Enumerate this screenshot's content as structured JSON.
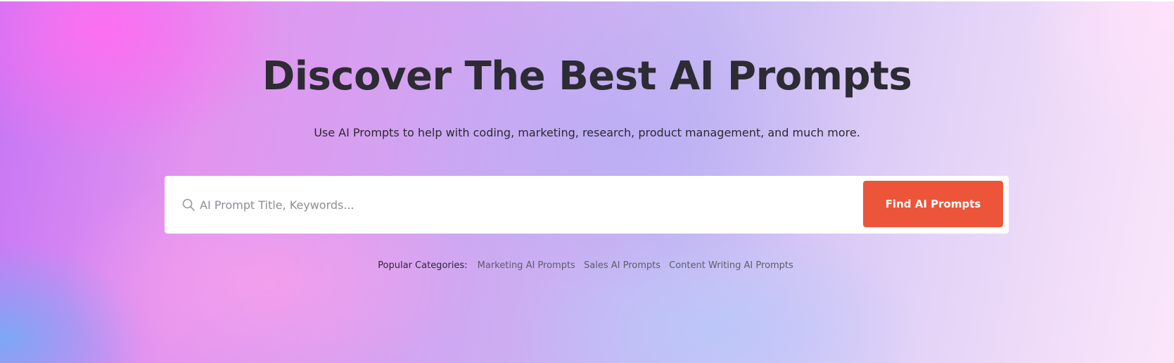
{
  "hero": {
    "title": "Discover The Best AI Prompts",
    "subtitle": "Use AI Prompts to help with coding, marketing, research, product management, and much more."
  },
  "search": {
    "placeholder": "AI Prompt Title, Keywords...",
    "value": "",
    "icon": "search-icon",
    "button_label": "Find AI Prompts",
    "button_color": "#ec553a"
  },
  "categories": {
    "label": "Popular Categories:",
    "items": [
      "Marketing AI Prompts",
      "Sales AI Prompts",
      "Content Writing AI Prompts"
    ]
  }
}
